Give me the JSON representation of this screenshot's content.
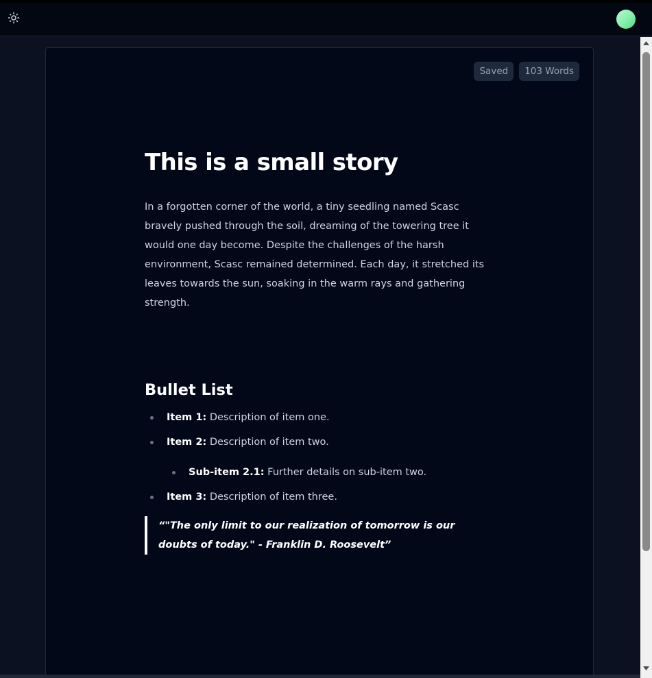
{
  "header": {
    "theme_icon": "sun-icon",
    "avatar_gradient": [
      "#bbf7d0",
      "#4ade80"
    ]
  },
  "status": {
    "saved": "Saved",
    "word_count": "103 Words"
  },
  "document": {
    "title": "This is a small story",
    "paragraph": "In a forgotten corner of the world, a tiny seedling named Scasc bravely pushed through the soil, dreaming of the towering tree it would one day become. Despite the challenges of the harsh environment, Scasc remained determined. Each day, it stretched its leaves towards the sun, soaking in the warm rays and gathering strength.",
    "list_heading": "Bullet List",
    "items": [
      {
        "label": "Item 1:",
        "text": " Description of item one."
      },
      {
        "label": "Item 2:",
        "text": " Description of item two."
      },
      {
        "label": "Item 3:",
        "text": " Description of item three."
      }
    ],
    "subitems": [
      {
        "label": "Sub-item 2.1:",
        "text": " Further details on sub-item two."
      }
    ],
    "quote": "“\"The only limit to our realization of tomorrow is our doubts of today.\" - Franklin D. Roosevelt”"
  },
  "colors": {
    "background": "#0b1120",
    "editor_background": "#020817",
    "badge_background": "#1e293b",
    "text": "#cbd5e1",
    "heading": "#ffffff"
  }
}
